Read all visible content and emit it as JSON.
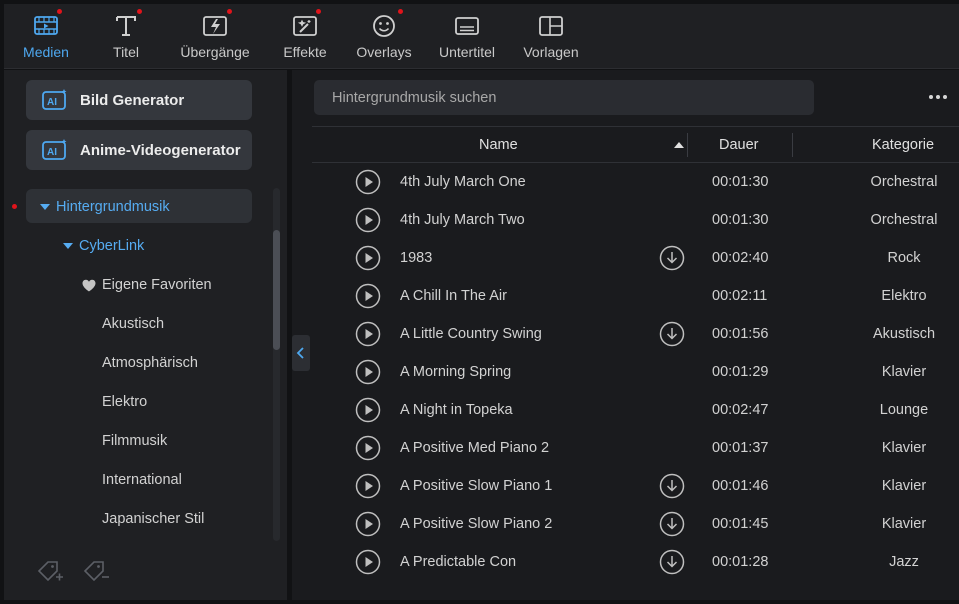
{
  "toolbar": {
    "items": [
      {
        "label": "Medien",
        "icon": "media-icon",
        "active": true,
        "badge": true
      },
      {
        "label": "Titel",
        "icon": "title-icon",
        "active": false,
        "badge": true
      },
      {
        "label": "Übergänge",
        "icon": "transitions-icon",
        "active": false,
        "badge": true
      },
      {
        "label": "Effekte",
        "icon": "effects-icon",
        "active": false,
        "badge": true
      },
      {
        "label": "Overlays",
        "icon": "overlays-icon",
        "active": false,
        "badge": true
      },
      {
        "label": "Untertitel",
        "icon": "subtitles-icon",
        "active": false,
        "badge": false
      },
      {
        "label": "Vorlagen",
        "icon": "templates-icon",
        "active": false,
        "badge": false
      }
    ]
  },
  "sidebar": {
    "generators": [
      {
        "label": "Bild Generator",
        "icon": "ai-icon"
      },
      {
        "label": "Anime-Videogenerator",
        "icon": "ai-icon"
      }
    ],
    "tree": {
      "root": "Hintergrundmusik",
      "child": "CyberLink",
      "favorites": "Eigene Favoriten",
      "items": [
        "Akustisch",
        "Atmosphärisch",
        "Elektro",
        "Filmmusik",
        "International",
        "Japanischer Stil"
      ]
    }
  },
  "main": {
    "search_placeholder": "Hintergrundmusik suchen",
    "columns": {
      "name": "Name",
      "duration": "Dauer",
      "category": "Kategorie"
    },
    "tracks": [
      {
        "name": "4th July March One",
        "duration": "00:01:30",
        "category": "Orchestral",
        "download": false
      },
      {
        "name": "4th July March Two",
        "duration": "00:01:30",
        "category": "Orchestral",
        "download": false
      },
      {
        "name": "1983",
        "duration": "00:02:40",
        "category": "Rock",
        "download": true
      },
      {
        "name": "A Chill In The Air",
        "duration": "00:02:11",
        "category": "Elektro",
        "download": false
      },
      {
        "name": "A Little Country Swing",
        "duration": "00:01:56",
        "category": "Akustisch",
        "download": true
      },
      {
        "name": "A Morning Spring",
        "duration": "00:01:29",
        "category": "Klavier",
        "download": false
      },
      {
        "name": "A Night in Topeka",
        "duration": "00:02:47",
        "category": "Lounge",
        "download": false
      },
      {
        "name": "A Positive Med Piano 2",
        "duration": "00:01:37",
        "category": "Klavier",
        "download": false
      },
      {
        "name": "A Positive Slow Piano 1",
        "duration": "00:01:46",
        "category": "Klavier",
        "download": true
      },
      {
        "name": "A Positive Slow Piano 2",
        "duration": "00:01:45",
        "category": "Klavier",
        "download": true
      },
      {
        "name": "A Predictable Con",
        "duration": "00:01:28",
        "category": "Jazz",
        "download": true
      }
    ]
  },
  "colors": {
    "accent": "#4ea8f0",
    "badge": "#e0141b"
  }
}
